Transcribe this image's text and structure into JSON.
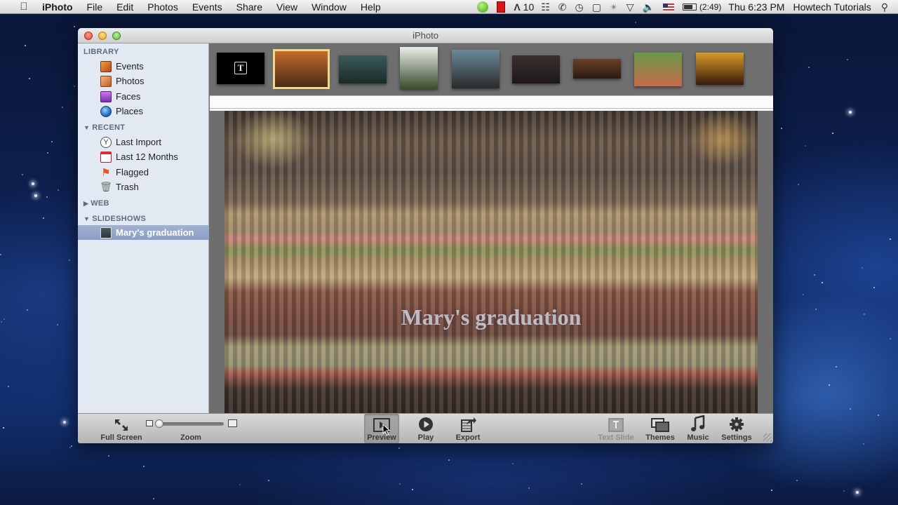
{
  "menubar": {
    "apple_icon": "apple-logo-icon",
    "app_name": "iPhoto",
    "items": [
      "File",
      "Edit",
      "Photos",
      "Events",
      "Share",
      "View",
      "Window",
      "Help"
    ],
    "status": {
      "adobe_count": "10",
      "battery_time": "(2:49)",
      "clock": "Thu 6:23 PM",
      "user": "Howtech Tutorials"
    }
  },
  "window": {
    "title": "iPhoto"
  },
  "sidebar": {
    "sections": [
      {
        "header": "LIBRARY",
        "collapsible": false,
        "items": [
          {
            "label": "Events",
            "icon": "events-icon"
          },
          {
            "label": "Photos",
            "icon": "photos-icon"
          },
          {
            "label": "Faces",
            "icon": "faces-icon"
          },
          {
            "label": "Places",
            "icon": "places-globe-icon"
          }
        ]
      },
      {
        "header": "RECENT",
        "collapsible": true,
        "expanded": true,
        "items": [
          {
            "label": "Last Import",
            "icon": "last-import-clock-icon"
          },
          {
            "label": "Last 12 Months",
            "icon": "calendar-icon"
          },
          {
            "label": "Flagged",
            "icon": "flag-icon"
          },
          {
            "label": "Trash",
            "icon": "trash-icon"
          }
        ]
      },
      {
        "header": "WEB",
        "collapsible": true,
        "expanded": false,
        "items": []
      },
      {
        "header": "SLIDESHOWS",
        "collapsible": true,
        "expanded": true,
        "items": [
          {
            "label": "Mary's graduation",
            "icon": "slideshow-icon",
            "selected": true
          }
        ]
      }
    ]
  },
  "thumbnails": [
    {
      "name": "title-slide",
      "description": "Text title slide",
      "selected": false,
      "colors": [
        "#000000",
        "#000000"
      ]
    },
    {
      "name": "ceremony-hall",
      "description": "Graduation ceremony hall",
      "selected": true,
      "colors": [
        "#c46a2a",
        "#4a2a18"
      ]
    },
    {
      "name": "crowd-stadium",
      "description": "Seated graduates crowd",
      "selected": false,
      "colors": [
        "#3a5a5a",
        "#1c2a2a"
      ]
    },
    {
      "name": "tower-group",
      "description": "Group at tower",
      "selected": false,
      "colors": [
        "#e8eee8",
        "#3a4a2a"
      ]
    },
    {
      "name": "graduates-outdoor",
      "description": "Graduates outdoors",
      "selected": false,
      "colors": [
        "#6a8a9a",
        "#2a2a2a"
      ]
    },
    {
      "name": "two-graduates",
      "description": "Two smiling graduates",
      "selected": false,
      "colors": [
        "#3a3030",
        "#1e1818"
      ]
    },
    {
      "name": "hall-dim",
      "description": "Dim hall panorama",
      "selected": false,
      "colors": [
        "#6a4028",
        "#2a1a12"
      ]
    },
    {
      "name": "champagne-glasses",
      "description": "Champagne toast",
      "selected": false,
      "colors": [
        "#6a9a4a",
        "#c86a4a"
      ]
    },
    {
      "name": "fireworks",
      "description": "Fireworks",
      "selected": false,
      "colors": [
        "#d89a2a",
        "#3a1a0a"
      ]
    }
  ],
  "slide": {
    "title_text": "Mary's graduation"
  },
  "toolbar": {
    "full_screen": "Full Screen",
    "zoom": "Zoom",
    "zoom_level": 0,
    "preview": "Preview",
    "play": "Play",
    "export": "Export",
    "text_slide": "Text Slide",
    "themes": "Themes",
    "music": "Music",
    "settings": "Settings"
  }
}
